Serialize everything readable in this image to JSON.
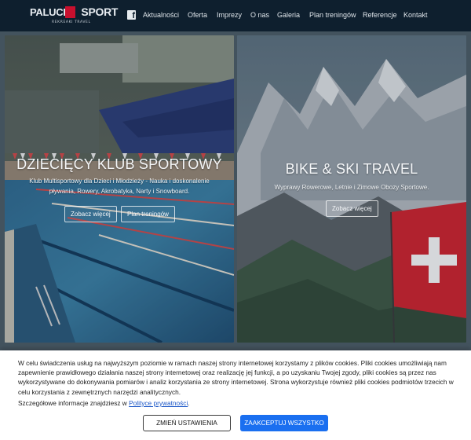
{
  "logo": {
    "word1": "PALUCH",
    "word2": "SPORT",
    "tagline": "REKREAKI TRAVEL"
  },
  "nav": {
    "facebook_icon": "facebook-icon",
    "items": [
      "Aktualności",
      "Oferta",
      "Imprezy",
      "O nas",
      "Galeria",
      "Plan treningów",
      "Referencje",
      "Kontakt"
    ]
  },
  "panels": {
    "left": {
      "title": "DZIECIĘCY KLUB SPORTOWY",
      "description": "Klub Multisportowy dla Dzieci i Młodzieży - Nauka i doskonalenie pływania, Rowery, Akrobatyka, Narty i Snowboard.",
      "button1": "Zobacz więcej",
      "button2": "Plan treningów"
    },
    "right": {
      "title": "BIKE & SKI TRAVEL",
      "description": "Wyprawy Rowerowe, Letnie i Zimowe Obozy Sportowe.",
      "button1": "Zobacz więcej"
    }
  },
  "cookie": {
    "text": "W celu świadczenia usług na najwyższym poziomie w ramach naszej strony internetowej korzystamy z plików cookies. Pliki cookies umożliwiają nam zapewnienie prawidłowego działania naszej strony internetowej oraz realizację jej funkcji, a po uzyskaniu Twojej zgody, pliki cookies są przez nas wykorzystywane do dokonywania pomiarów i analiz korzystania ze strony internetowej. Strona wykorzystuje również pliki cookies podmiotów trzecich w celu korzystania z zewnętrznych narzędzi analitycznych.",
    "more_prefix": "Szczegółowe informacje znajdziesz w",
    "more_link": "Polityce prywatności",
    "more_suffix": ".",
    "settings_button": "ZMIEŃ USTAWIENIA",
    "accept_button": "ZAAKCEPTUJ WSZYSTKO"
  },
  "colors": {
    "nav_bg": "#0e1f2e",
    "accept_blue": "#1a6ff0",
    "link_blue": "#1a56c7",
    "logo_red": "#c8102e"
  }
}
